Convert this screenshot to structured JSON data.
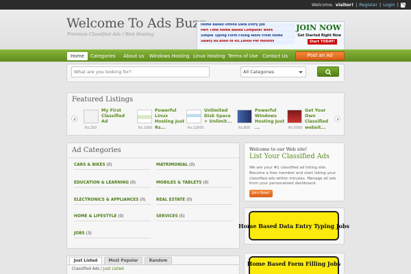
{
  "topbar": {
    "welcome_prefix": "Welcome,",
    "username": "visitor!",
    "sep1": "|",
    "register": "Register",
    "sep2": "|",
    "login": "Login",
    "sep3": "|",
    "rss_icon": "rss-icon"
  },
  "header": {
    "title": "Welcome To Ads Buzz",
    "tagline": "Premium Classified Ads / Web Hosting",
    "banner": {
      "lines": [
        "Home Based Offline Data Entry Job",
        "Part Time Home Based Computer Work",
        "Simple Typing Form Filling Work From Home",
        "Salary Rs.8000 to Rs.19000 Per months"
      ],
      "headline": "JOIN NOW",
      "subline": "Get Started Right Now",
      "cta": "Start TODAY!"
    }
  },
  "nav": {
    "items": [
      "Home",
      "Categories",
      "About us",
      "Windows Hosting",
      "Linux Hosting",
      "Terms of Use",
      "Contact Us"
    ],
    "post_ad": "Post an Ad"
  },
  "search": {
    "placeholder": "What are you looking for?",
    "category_value": "All Categories",
    "button_icon": "search-icon"
  },
  "featured": {
    "title": "Featured Listings",
    "items": [
      {
        "title": "My First Classified Ad",
        "price": "Rs.250"
      },
      {
        "title": "Powerful Linux Hosting Just Rs...",
        "price": "Rs.1000"
      },
      {
        "title": "Unlimited Disk Space + Unlimit...",
        "price": "Rs.12000"
      },
      {
        "title": "Powerful Windows Hosting Just ...",
        "price": "Rs.800"
      },
      {
        "title": "Get Your Own Classified websit...",
        "price": "Rs.5000"
      }
    ]
  },
  "ad_categories": {
    "title": "Ad Categories",
    "items": [
      {
        "name": "CARS & BIKES",
        "count": "(0)"
      },
      {
        "name": "MATRIMONIAL",
        "count": "(0)"
      },
      {
        "name": "EDUCATION & LEARNING",
        "count": "(0)"
      },
      {
        "name": "MOBILES & TABLETS",
        "count": "(0)"
      },
      {
        "name": "ELECTRONICS & APPLIANCES",
        "count": "(0)"
      },
      {
        "name": "REAL ESTATE",
        "count": "(0)"
      },
      {
        "name": "HOME & LIFESTYLE",
        "count": "(0)"
      },
      {
        "name": "SERVICES",
        "count": "(5)"
      },
      {
        "name": "JOBS",
        "count": "(3)"
      }
    ]
  },
  "welcome_box": {
    "line1": "Welcome to our Web site!",
    "line2": "List Your Classified Ads",
    "text": "We are your #1 classified ad listing site. Become a free member and start listing your classified ads within minutes. Manage all ads from your personalized dashboard.",
    "button": "Join Now!"
  },
  "side_ads": [
    {
      "text": "Home Based Data Entry Typing Jobs"
    },
    {
      "text": "Home Based Form Filling Jobs"
    }
  ],
  "tabs": {
    "items": [
      "Just Listed",
      "Most Popular",
      "Random"
    ],
    "active": "Just Listed",
    "breadcrumb_root": "Classified Ads",
    "breadcrumb_sep": "/",
    "breadcrumb_current": "Just Listed"
  }
}
